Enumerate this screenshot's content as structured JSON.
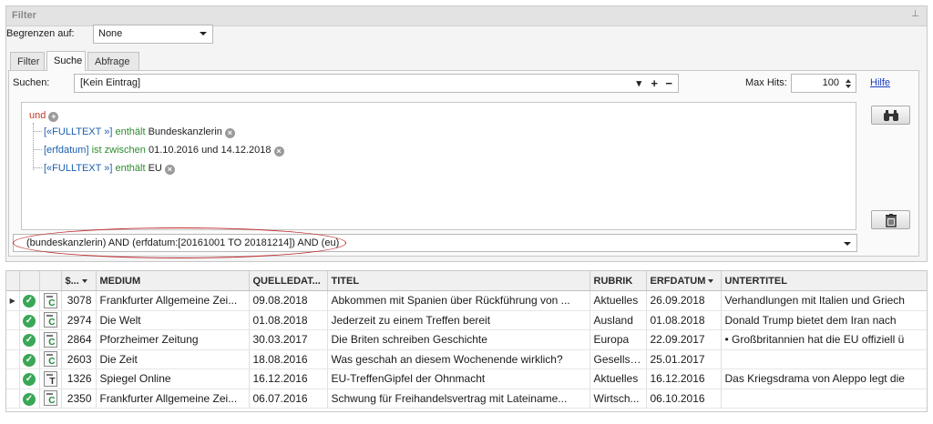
{
  "filter_panel": {
    "title": "Filter",
    "pin_icon": "pin-icon",
    "limit_label": "Begrenzen auf:",
    "limit_value": "None",
    "tabs": [
      {
        "label": "Filter",
        "active": false
      },
      {
        "label": "Suche",
        "active": true
      },
      {
        "label": "Abfrage",
        "active": false
      }
    ],
    "search_label": "Suchen:",
    "search_value": "[Kein Eintrag]",
    "search_buttons": {
      "dropdown": "▾",
      "add": "+",
      "remove": "−"
    },
    "maxhits_label": "Max Hits:",
    "maxhits_value": "100",
    "help_link": "Hilfe",
    "tree": {
      "operator": "und",
      "conditions": [
        {
          "field": "[«FULLTEXT »]",
          "op": "enthält",
          "value": "Bundeskanzlerin"
        },
        {
          "field": "[erfdatum]",
          "op": "ist zwischen",
          "value": "01.10.2016 und 14.12.2018"
        },
        {
          "field": "[«FULLTEXT »]",
          "op": "enthält",
          "value": "EU"
        }
      ]
    },
    "query_text": "(bundeskanzlerin) AND (erfdatum:[20161001 TO  20181214]) AND (eu)",
    "highlight_color": "#c0282c"
  },
  "grid": {
    "columns": [
      "",
      "",
      "",
      "$...",
      "MEDIUM",
      "QUELLEDAT...",
      "TITEL",
      "RUBRIK",
      "ERFDATUM",
      "UNTERTITEL"
    ],
    "rows": [
      {
        "current": true,
        "doc": "C",
        "id": "3078",
        "medium": "Frankfurter Allgemeine Zei...",
        "quelledatum": "09.08.2018",
        "titel": "Abkommen mit Spanien über Rückführung von ...",
        "rubrik": "Aktuelles",
        "erfdatum": "26.09.2018",
        "untertitel": "Verhandlungen mit Italien und Griech"
      },
      {
        "current": false,
        "doc": "C",
        "id": "2974",
        "medium": "Die Welt",
        "quelledatum": "01.08.2018",
        "titel": "Jederzeit zu einem Treffen bereit",
        "rubrik": "Ausland",
        "erfdatum": "01.08.2018",
        "untertitel": "Donald Trump bietet dem Iran nach"
      },
      {
        "current": false,
        "doc": "C",
        "id": "2864",
        "medium": "Pforzheimer Zeitung",
        "quelledatum": "30.03.2017",
        "titel": "Die Briten schreiben Geschichte",
        "rubrik": "Europa",
        "erfdatum": "22.09.2017",
        "untertitel": "• Großbritannien hat die EU offiziell ü"
      },
      {
        "current": false,
        "doc": "C",
        "id": "2603",
        "medium": "Die Zeit",
        "quelledatum": "18.08.2016",
        "titel": "Was geschah an diesem Wochenende wirklich?",
        "rubrik": "Gesellsc...",
        "erfdatum": "25.01.2017",
        "untertitel": ""
      },
      {
        "current": false,
        "doc": "T",
        "id": "1326",
        "medium": "Spiegel Online",
        "quelledatum": "16.12.2016",
        "titel": "EU-TreffenGipfel der Ohnmacht",
        "rubrik": "Aktuelles",
        "erfdatum": "16.12.2016",
        "untertitel": "Das Kriegsdrama von Aleppo legt die"
      },
      {
        "current": false,
        "doc": "C",
        "id": "2350",
        "medium": "Frankfurter Allgemeine Zei...",
        "quelledatum": "06.07.2016",
        "titel": "Schwung für Freihandelsvertrag mit Lateiname...",
        "rubrik": "Wirtsch...",
        "erfdatum": "06.10.2016",
        "untertitel": ""
      }
    ]
  }
}
